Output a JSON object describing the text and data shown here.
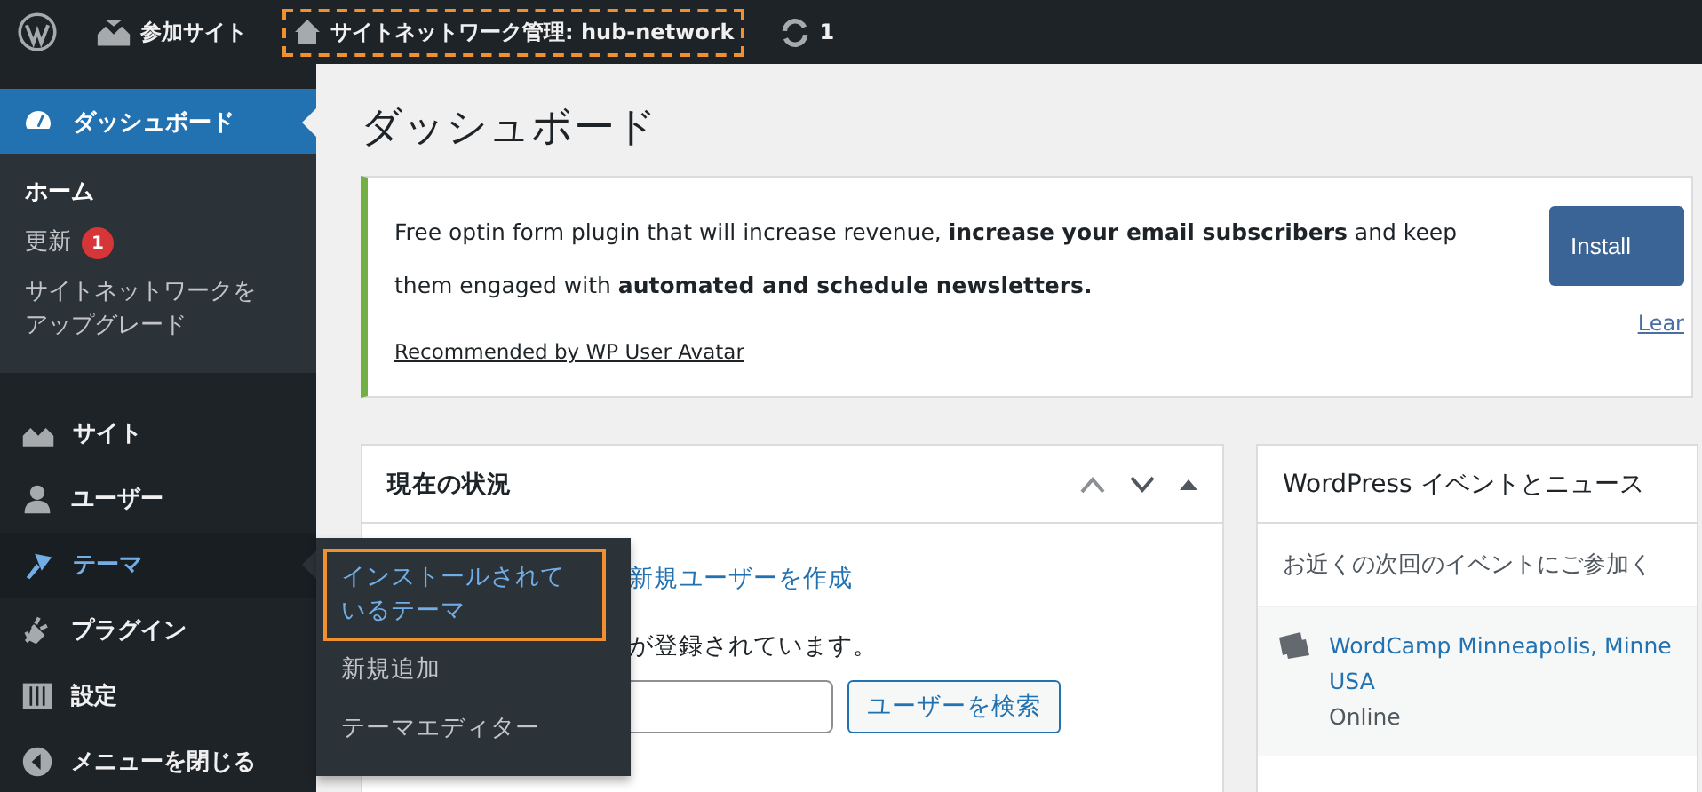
{
  "admin_bar": {
    "items": [
      {
        "kind": "sites",
        "label": "参加サイト",
        "highlighted": false
      },
      {
        "kind": "network",
        "label": "サイトネットワーク管理: hub-network",
        "highlighted": true
      },
      {
        "kind": "updates",
        "label": "1",
        "highlighted": false
      }
    ]
  },
  "sidebar": {
    "items": [
      {
        "kind": "dashboard",
        "label": "ダッシュボード",
        "selected": true,
        "open": false,
        "submenu": [
          {
            "label": "ホーム",
            "selected": true
          },
          {
            "label": "更新",
            "badge": "1",
            "selected": false
          },
          {
            "label": "サイトネットワークをアップグレード",
            "selected": false
          }
        ]
      },
      {
        "kind": "sites",
        "label": "サイト",
        "selected": false,
        "open": false
      },
      {
        "kind": "users",
        "label": "ユーザー",
        "selected": false,
        "open": false
      },
      {
        "kind": "themes",
        "label": "テーマ",
        "selected": false,
        "open": true,
        "flyout": [
          {
            "label": "インストールされているテーマ",
            "selected": true,
            "highlighted": true
          },
          {
            "label": "新規追加",
            "selected": false,
            "highlighted": false
          },
          {
            "label": "テーマエディター",
            "selected": false,
            "highlighted": false
          }
        ]
      },
      {
        "kind": "plugins",
        "label": "プラグイン",
        "selected": false,
        "open": false
      },
      {
        "kind": "settings",
        "label": "設定",
        "selected": false,
        "open": false
      },
      {
        "kind": "collapse",
        "label": "メニューを閉じる",
        "selected": false,
        "open": false
      }
    ]
  },
  "page": {
    "title": "ダッシュボード"
  },
  "notice": {
    "text": "Free optin form plugin that will increase revenue, **increase your email subscribers** and keep them engaged with **automated and schedule newsletters.**",
    "link": "Recommended by WP User Avatar",
    "button": "Install",
    "secondary_link": "Lear"
  },
  "status_widget": {
    "title": "現在の状況",
    "link": "新規ユーザーを作成",
    "text": "が登録されています。",
    "search_button": "ユーザーを検索"
  },
  "events_widget": {
    "title": "WordPress イベントとニュース",
    "intro": "お近くの次回のイベントにご参加く",
    "events": [
      {
        "title": "WordCamp Minneapolis, Minne\nUSA",
        "location": "Online"
      }
    ]
  }
}
